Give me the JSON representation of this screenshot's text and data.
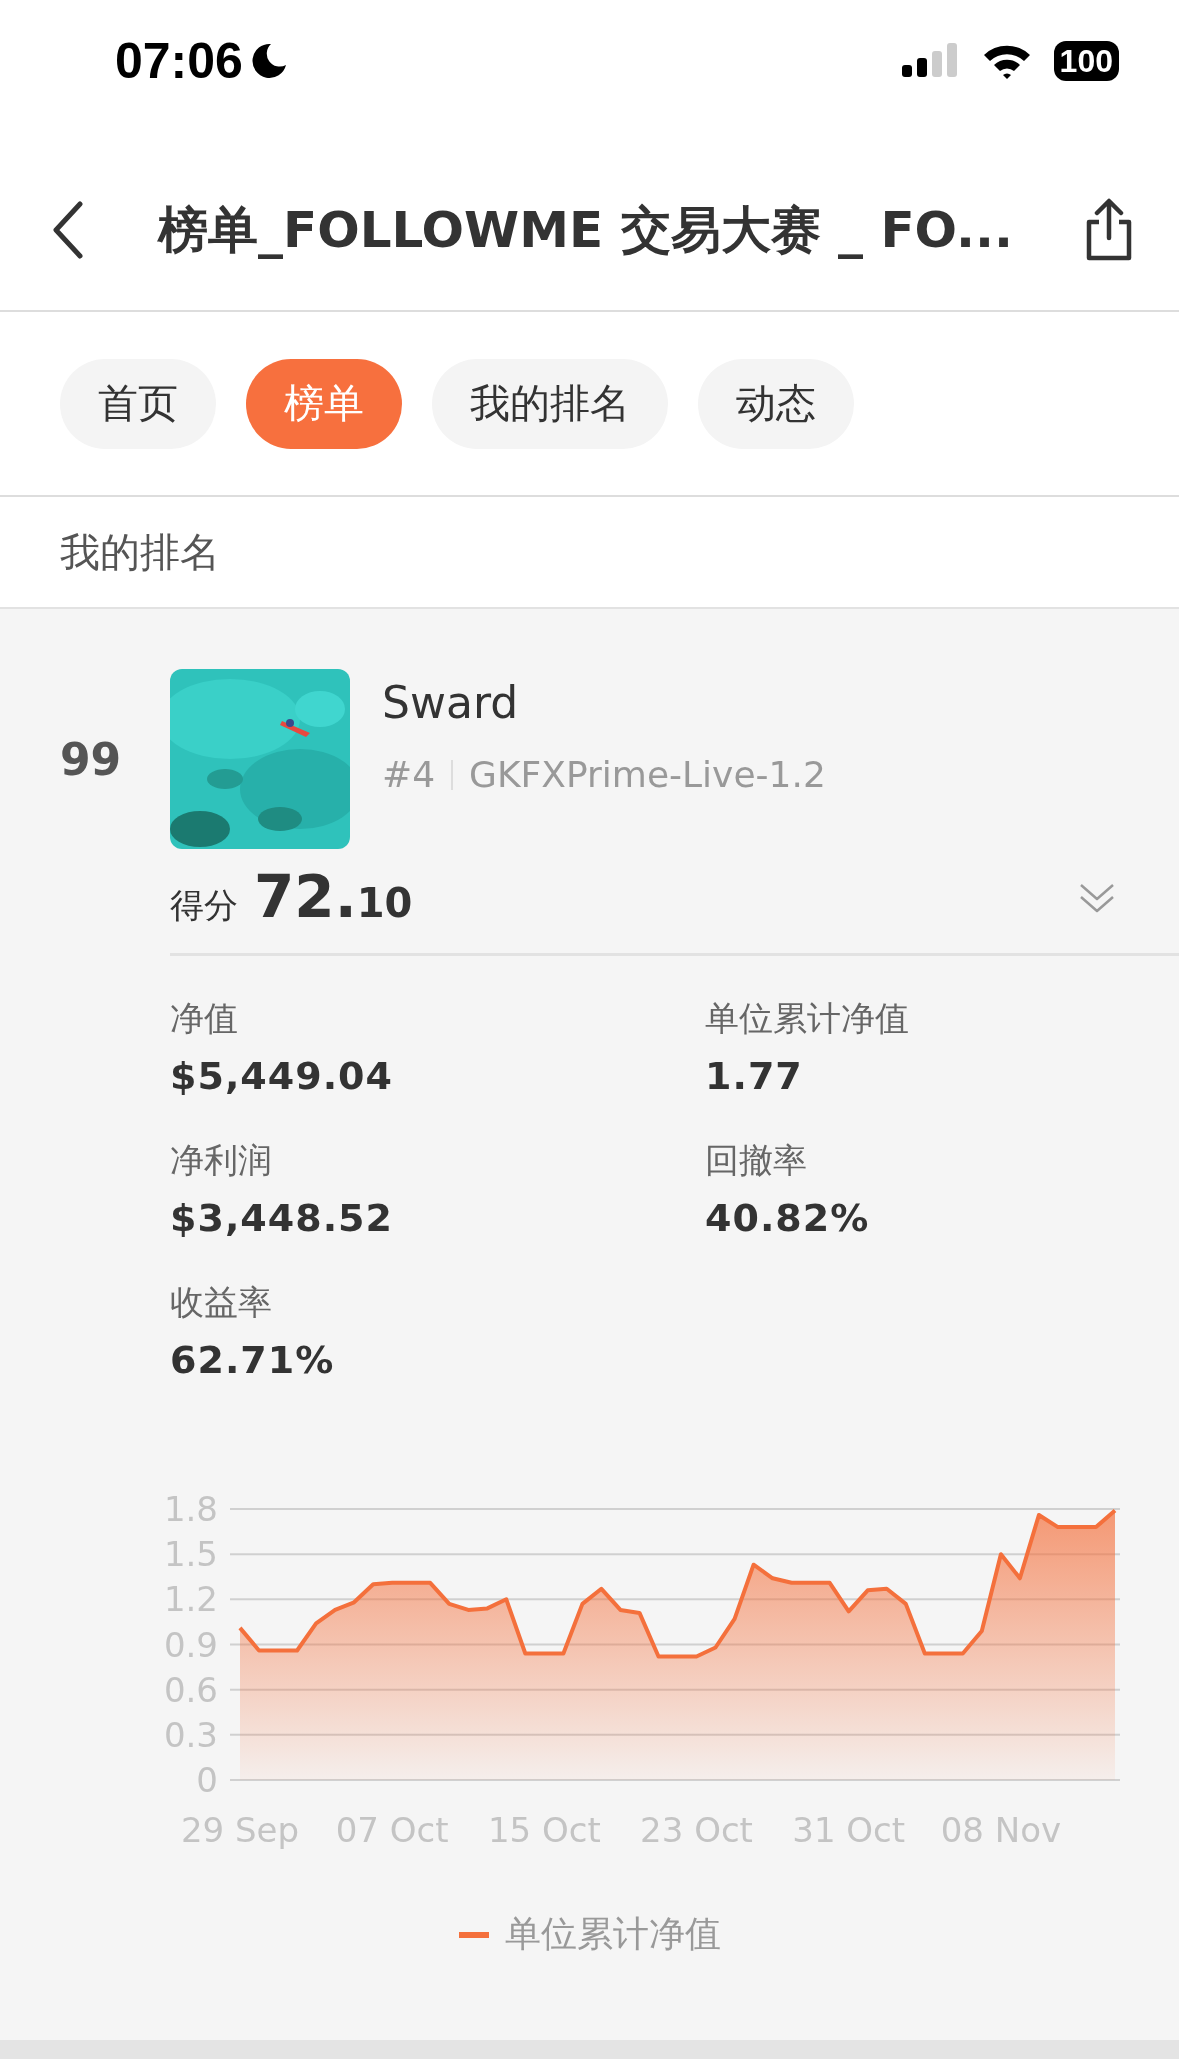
{
  "status_bar": {
    "time": "07:06",
    "battery": "100"
  },
  "nav": {
    "title": "榜单_FOLLOWME 交易大赛 _ FO..."
  },
  "tabs": [
    {
      "label": "首页",
      "selected": false
    },
    {
      "label": "榜单",
      "selected": true
    },
    {
      "label": "我的排名",
      "selected": false
    },
    {
      "label": "动态",
      "selected": false
    }
  ],
  "section_title": "我的排名",
  "entry": {
    "rank": "99",
    "name": "Sward",
    "number": "#4",
    "server": "GKFXPrime-Live-1.2",
    "score_label": "得分",
    "score_int": "72.",
    "score_dec": "10",
    "stats": [
      {
        "label": "净值",
        "value": "$5,449.04"
      },
      {
        "label": "单位累计净值",
        "value": "1.77"
      },
      {
        "label": "净利润",
        "value": "$3,448.52"
      },
      {
        "label": "回撤率",
        "value": "40.82%"
      },
      {
        "label": "收益率",
        "value": "62.71%"
      }
    ],
    "chart_data": {
      "type": "area",
      "categories": [
        "29 Sep",
        null,
        null,
        null,
        null,
        null,
        null,
        null,
        "07 Oct",
        null,
        null,
        null,
        null,
        null,
        null,
        null,
        "15 Oct",
        null,
        null,
        null,
        null,
        null,
        null,
        null,
        "23 Oct",
        null,
        null,
        null,
        null,
        null,
        null,
        null,
        "31 Oct",
        null,
        null,
        null,
        null,
        null,
        null,
        null,
        "08 Nov",
        null,
        null,
        null,
        null,
        null,
        null
      ],
      "series": [
        {
          "name": "单位累计净值",
          "color": "#f4703c",
          "values": [
            1.01,
            0.86,
            0.86,
            0.86,
            1.04,
            1.13,
            1.18,
            1.3,
            1.31,
            1.31,
            1.31,
            1.17,
            1.13,
            1.14,
            1.2,
            0.84,
            0.84,
            0.84,
            1.17,
            1.27,
            1.13,
            1.11,
            0.82,
            0.82,
            0.82,
            0.88,
            1.07,
            1.43,
            1.34,
            1.31,
            1.31,
            1.31,
            1.12,
            1.26,
            1.27,
            1.17,
            0.84,
            0.84,
            0.84,
            0.99,
            1.5,
            1.34,
            1.76,
            1.68,
            1.68,
            1.68,
            1.79
          ]
        }
      ],
      "ylim": [
        0,
        1.8
      ],
      "grid": true,
      "yticks": [
        0,
        0.3,
        0.6,
        0.9,
        1.2,
        1.5,
        1.8
      ]
    }
  }
}
